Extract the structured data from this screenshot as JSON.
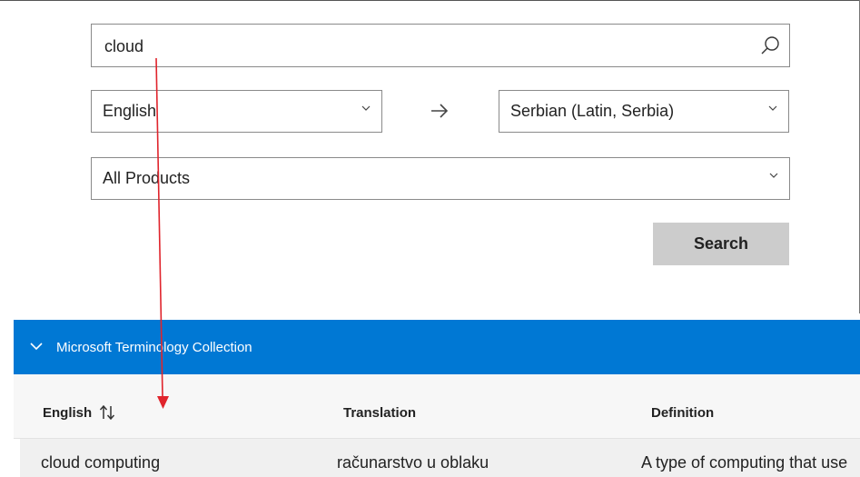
{
  "search": {
    "value": "cloud"
  },
  "languages": {
    "from": "English",
    "to": "Serbian (Latin, Serbia)"
  },
  "product": {
    "selected": "All Products"
  },
  "actions": {
    "search_label": "Search"
  },
  "collection": {
    "title": "Microsoft Terminology Collection"
  },
  "table": {
    "headers": {
      "english": "English",
      "translation": "Translation",
      "definition": "Definition"
    },
    "rows": [
      {
        "english": "cloud computing",
        "translation": "računarstvo u oblaku",
        "definition": "A type of computing that use"
      }
    ]
  },
  "colors": {
    "accent": "#0078d4",
    "annotation": "#e0242c",
    "button": "#cccccc"
  },
  "icons": {
    "search": "search-icon",
    "dropdown": "chevron-down-icon",
    "swap": "arrow-right-icon",
    "collapse": "chevron-down-icon",
    "sort": "sort-icon"
  }
}
